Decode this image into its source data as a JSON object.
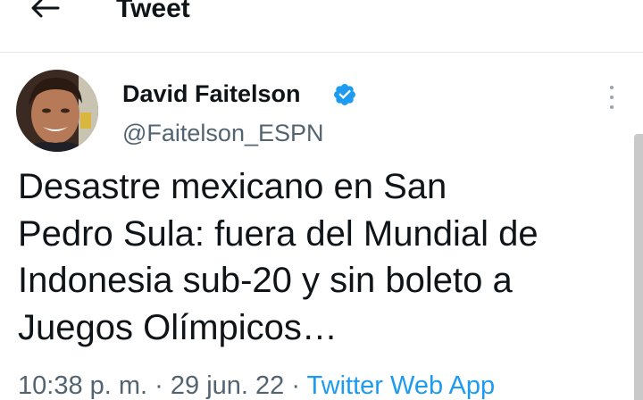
{
  "header": {
    "title": "Tweet",
    "back_icon": "back-arrow-icon"
  },
  "tweet": {
    "author": {
      "name": "David Faitelson",
      "handle": "@Faitelson_ESPN",
      "verified_icon": "verified-badge-icon"
    },
    "menu_icon": "more-vertical-icon",
    "text_lines": [
      "Desastre mexicano en San",
      "Pedro Sula: fuera del Mundial de",
      "Indonesia sub-20 y sin boleto a",
      "Juegos Olímpicos…"
    ],
    "time": "10:38 p. m.",
    "separator": " · ",
    "date": "29 jun. 22",
    "source": "Twitter Web App"
  },
  "colors": {
    "text": "#0f1419",
    "secondary": "#536471",
    "accent": "#1d9bf0"
  }
}
